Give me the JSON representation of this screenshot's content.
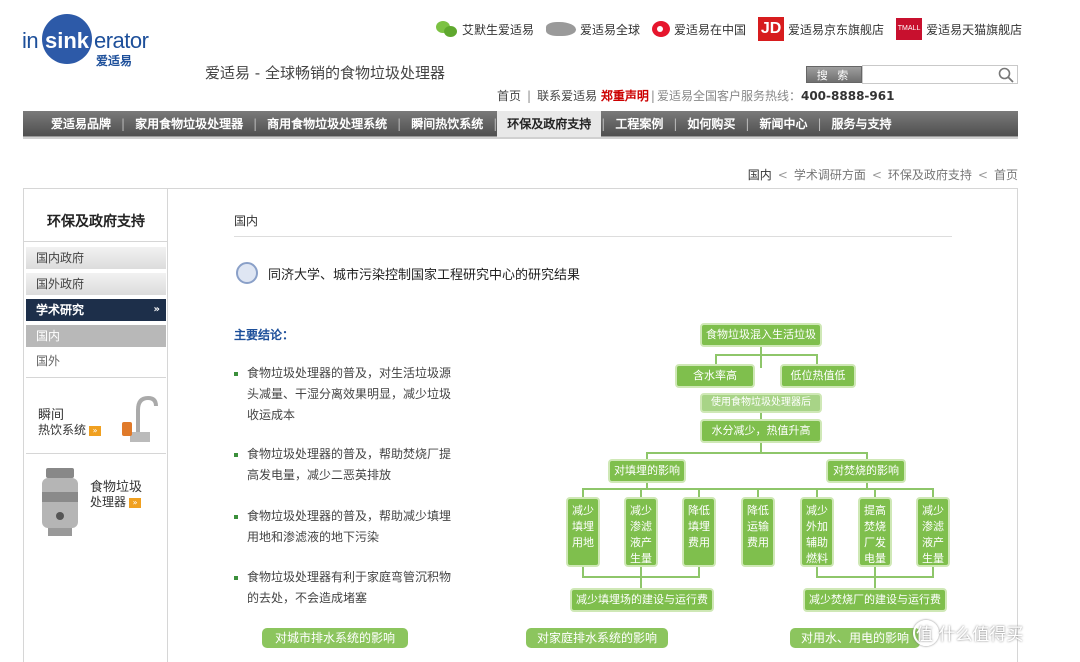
{
  "brand": {
    "logo_left": "in",
    "logo_circle": "sink",
    "logo_right": "erator",
    "logo_sub": "爱适易",
    "tagline": "爱适易 - 全球畅销的食物垃圾处理器"
  },
  "top_links": {
    "wechat": "艾默生爱适易",
    "global": "爱适易全球",
    "weibo": "爱适易在中国",
    "jd_icon": "JD",
    "jd": "爱适易京东旗舰店",
    "tmall_icon": "TMALL",
    "tmall": "爱适易天猫旗舰店"
  },
  "search": {
    "button": "搜 索",
    "placeholder": ""
  },
  "sublinks": {
    "home": "首页",
    "contact": "联系爱适易",
    "notice": "郑重声明",
    "hotline_label": "爱适易全国客户服务热线：",
    "hotline": "400-8888-961"
  },
  "nav": {
    "items": [
      "爱适易品牌",
      "家用食物垃圾处理器",
      "商用食物垃圾处理系统",
      "瞬间热饮系统",
      "环保及政府支持",
      "工程案例",
      "如何购买",
      "新闻中心",
      "服务与支持"
    ],
    "active_index": 4
  },
  "breadcrumb": {
    "current": "国内",
    "level2": "学术调研方面",
    "level1": "环保及政府支持",
    "home": "首页"
  },
  "sidebar": {
    "title": "环保及政府支持",
    "items": [
      "国内政府",
      "国外政府",
      "学术研究"
    ],
    "active_chevron": "»",
    "sub_items": [
      "国内",
      "国外"
    ],
    "promo1_line1": "瞬间",
    "promo1_line2": "热饮系统",
    "promo2_line1": "食物垃圾",
    "promo2_line2": "处理器",
    "promo_tag": "»"
  },
  "main": {
    "heading": "国内",
    "study_title": "同济大学、城市污染控制国家工程研究中心的研究结果",
    "conclusion_label": "主要结论：",
    "bullets": [
      "食物垃圾处理器的普及，对生活垃圾源头减量、干湿分离效果明显，减少垃圾收运成本",
      "食物垃圾处理器的普及，帮助焚烧厂提高发电量，减少二恶英排放",
      "食物垃圾处理器的普及，帮助减少填埋用地和渗滤液的地下污染",
      "食物垃圾处理器有利于家庭弯管沉积物的去处，不会造成堵塞"
    ]
  },
  "flowchart": {
    "top": "食物垃圾混入生活垃圾",
    "left_cause": "含水率高",
    "right_cause": "低位热值低",
    "using": "使用食物垃圾处理器后",
    "result": "水分减少，热值升高",
    "landfill": "对填埋的影响",
    "incineration": "对焚烧的影响",
    "effects": [
      "减少填埋用地",
      "减少渗滤液产生量",
      "降低填埋费用",
      "降低运输费用",
      "减少外加辅助燃料",
      "提高焚烧厂发电量",
      "减少渗滤液产生量"
    ],
    "landfill_cost": "减少填埋场的建设与运行费用",
    "incineration_cost": "减少焚烧厂的建设与运行费用"
  },
  "bottom_tags": [
    "对城市排水系统的影响",
    "对家庭排水系统的影响",
    "对用水、用电的影响"
  ],
  "watermark": "值 什么值得买",
  "colors": {
    "nav_bg": "#5f5f5f",
    "sidebar_active": "#1d2f4a",
    "flow_green": "#7fbf4d",
    "accent_red": "#cc0000",
    "link_blue": "#1d4f9a"
  }
}
